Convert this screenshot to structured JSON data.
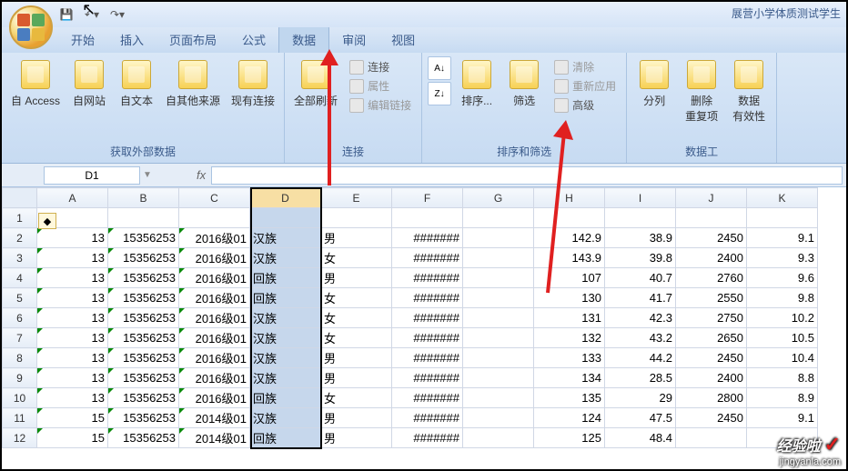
{
  "doc_title": "展营小学体质测试学生",
  "qat": {
    "save_tip": "保存",
    "undo_tip": "撤销",
    "redo_tip": "恢复"
  },
  "tabs": {
    "home": "开始",
    "insert": "插入",
    "layout": "页面布局",
    "formula": "公式",
    "data": "数据",
    "review": "审阅",
    "view": "视图"
  },
  "ribbon": {
    "ext_data": {
      "access": "自 Access",
      "web": "自网站",
      "text": "自文本",
      "other": "自其他来源",
      "conn": "现有连接",
      "label": "获取外部数据"
    },
    "connections": {
      "refresh": "全部刷新",
      "conn": "连接",
      "prop": "属性",
      "edit": "编辑链接",
      "label": "连接"
    },
    "sort_filter": {
      "az": "A→Z",
      "za": "Z→A",
      "sort": "排序...",
      "filter": "筛选",
      "clear": "清除",
      "reapply": "重新应用",
      "adv": "高级",
      "label": "排序和筛选"
    },
    "tools": {
      "split": "分列",
      "dedup": "删除",
      "dedup2": "重复项",
      "valid": "数据",
      "valid2": "有效性",
      "label": "数据工"
    }
  },
  "namebox": "D1",
  "columns": [
    "A",
    "B",
    "C",
    "D",
    "E",
    "F",
    "G",
    "H",
    "I",
    "J",
    "K"
  ],
  "rows": [
    {
      "n": 1,
      "cells": [
        "",
        "",
        "",
        "",
        "",
        "",
        "",
        "",
        "",
        "",
        ""
      ]
    },
    {
      "n": 2,
      "cells": [
        "13",
        "15356253",
        "2016级01",
        "汉族",
        "男",
        "#######",
        "",
        "142.9",
        "38.9",
        "2450",
        "9.1"
      ]
    },
    {
      "n": 3,
      "cells": [
        "13",
        "15356253",
        "2016级01",
        "汉族",
        "女",
        "#######",
        "",
        "143.9",
        "39.8",
        "2400",
        "9.3"
      ]
    },
    {
      "n": 4,
      "cells": [
        "13",
        "15356253",
        "2016级01",
        "回族",
        "男",
        "#######",
        "",
        "107",
        "40.7",
        "2760",
        "9.6"
      ]
    },
    {
      "n": 5,
      "cells": [
        "13",
        "15356253",
        "2016级01",
        "回族",
        "女",
        "#######",
        "",
        "130",
        "41.7",
        "2550",
        "9.8"
      ]
    },
    {
      "n": 6,
      "cells": [
        "13",
        "15356253",
        "2016级01",
        "汉族",
        "女",
        "#######",
        "",
        "131",
        "42.3",
        "2750",
        "10.2"
      ]
    },
    {
      "n": 7,
      "cells": [
        "13",
        "15356253",
        "2016级01",
        "汉族",
        "女",
        "#######",
        "",
        "132",
        "43.2",
        "2650",
        "10.5"
      ]
    },
    {
      "n": 8,
      "cells": [
        "13",
        "15356253",
        "2016级01",
        "汉族",
        "男",
        "#######",
        "",
        "133",
        "44.2",
        "2450",
        "10.4"
      ]
    },
    {
      "n": 9,
      "cells": [
        "13",
        "15356253",
        "2016级01",
        "汉族",
        "男",
        "#######",
        "",
        "134",
        "28.5",
        "2400",
        "8.8"
      ]
    },
    {
      "n": 10,
      "cells": [
        "13",
        "15356253",
        "2016级01",
        "回族",
        "女",
        "#######",
        "",
        "135",
        "29",
        "2800",
        "8.9"
      ]
    },
    {
      "n": 11,
      "cells": [
        "15",
        "15356253",
        "2014级01",
        "汉族",
        "男",
        "#######",
        "",
        "124",
        "47.5",
        "2450",
        "9.1"
      ]
    },
    {
      "n": 12,
      "cells": [
        "15",
        "15356253",
        "2014级01",
        "回族",
        "男",
        "#######",
        "",
        "125",
        "48.4",
        "",
        " "
      ]
    }
  ],
  "watermark": {
    "brand": "经验啦",
    "url": "jingyanla.com"
  }
}
